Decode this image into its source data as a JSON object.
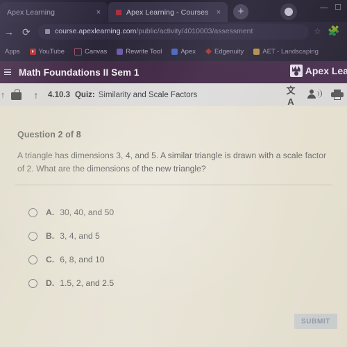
{
  "browser": {
    "tabs": [
      {
        "title": "Apex Learning",
        "close": "×",
        "active": false
      },
      {
        "title": "Apex Learning - Courses",
        "close": "×",
        "active": true
      }
    ],
    "new_tab_label": "+",
    "window_controls": {
      "minimize": "—",
      "maximize": "☐"
    },
    "nav": {
      "forward": "→",
      "reload": "⟳"
    },
    "url": {
      "host": "course.apexlearning.com",
      "path": "/public/activity/4010003/assessment"
    },
    "star_icon": "☆",
    "puzzle_icon": "🧩",
    "bookmarks": [
      {
        "label": "Apps",
        "icon": "apps-icon"
      },
      {
        "label": "YouTube",
        "icon": "youtube-icon"
      },
      {
        "label": "Canvas",
        "icon": "canvas-icon"
      },
      {
        "label": "Rewrite Tool",
        "icon": "rewrite-tool-icon"
      },
      {
        "label": "Apex",
        "icon": "apex-icon"
      },
      {
        "label": "Edgenuity",
        "icon": "edgenuity-icon"
      },
      {
        "label": "AET - Landscaping",
        "icon": "aet-icon"
      }
    ]
  },
  "app_header": {
    "course_title": "Math Foundations II Sem 1",
    "brand_text": "Apex Lea",
    "menu_icon": "hamburger-icon",
    "accent_color": "#402744"
  },
  "toolbar": {
    "back_icon": "↑",
    "briefcase_icon": "briefcase-icon",
    "upload_icon": "↑",
    "lesson_number": "4.10.3",
    "activity_type": "Quiz:",
    "activity_name": "Similarity and Scale Factors",
    "translate_icon": "文A",
    "read_aloud_icon": "read-aloud-icon",
    "print_icon": "print-icon"
  },
  "question": {
    "counter": "Question 2 of 8",
    "prompt": "A triangle has dimensions 3, 4, and 5. A similar triangle is drawn with a scale factor of 2. What are the dimensions of the new triangle?",
    "choices": [
      {
        "letter": "A.",
        "text": "30, 40, and 50",
        "selected": false
      },
      {
        "letter": "B.",
        "text": "3, 4, and 5",
        "selected": false
      },
      {
        "letter": "C.",
        "text": "6, 8, and 10",
        "selected": false
      },
      {
        "letter": "D.",
        "text": "1.5, 2, and 2.5",
        "selected": false
      }
    ]
  },
  "footer": {
    "submit_label": "SUBMIT"
  }
}
